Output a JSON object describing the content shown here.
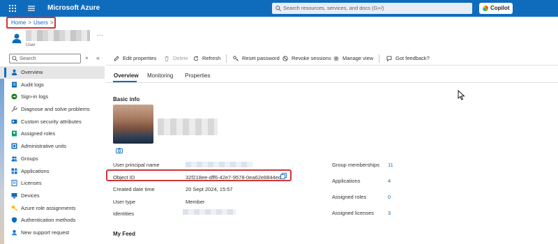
{
  "topbar": {
    "brand": "Microsoft Azure",
    "search_placeholder": "Search resources, services, and docs (G+/)",
    "copilot_label": "Copilot",
    "bg_color": "#0f6cbd"
  },
  "breadcrumb": {
    "home": "Home",
    "users": "Users"
  },
  "user": {
    "subtitle": "User"
  },
  "sidebar": {
    "search_placeholder": "Search",
    "items": [
      {
        "label": "Overview",
        "icon": "person-icon",
        "active": true
      },
      {
        "label": "Audit logs",
        "icon": "audit-log-icon"
      },
      {
        "label": "Sign-in logs",
        "icon": "sign-in-icon"
      },
      {
        "label": "Diagnose and solve problems",
        "icon": "wrench-icon"
      },
      {
        "label": "Custom security attributes",
        "icon": "attributes-icon"
      },
      {
        "label": "Assigned roles",
        "icon": "roles-icon"
      },
      {
        "label": "Administrative units",
        "icon": "admin-units-icon"
      },
      {
        "label": "Groups",
        "icon": "groups-icon"
      },
      {
        "label": "Applications",
        "icon": "applications-icon"
      },
      {
        "label": "Licenses",
        "icon": "licenses-icon"
      },
      {
        "label": "Devices",
        "icon": "devices-icon"
      },
      {
        "label": "Azure role assignments",
        "icon": "key-icon"
      },
      {
        "label": "Authentication methods",
        "icon": "shield-icon"
      },
      {
        "label": "New support request",
        "icon": "support-icon"
      }
    ]
  },
  "toolbar": {
    "edit": "Edit properties",
    "delete": "Delete",
    "refresh": "Refresh",
    "reset": "Reset password",
    "revoke": "Revoke sessions",
    "manage": "Manage view",
    "feedback": "Got feedback?"
  },
  "tabs": [
    "Overview",
    "Monitoring",
    "Properties"
  ],
  "basic_info": {
    "title": "Basic info",
    "props": {
      "upn_label": "User principal name",
      "objid_label": "Object ID",
      "objid_value": "32f218ee-dff6-42e7-9578-0ea62e8844ed",
      "created_label": "Created date time",
      "created_value": "20 Sept 2024, 15:57",
      "usertype_label": "User type",
      "usertype_value": "Member",
      "identities_label": "Identities"
    },
    "stats": [
      {
        "label": "Group memberships",
        "value": "11"
      },
      {
        "label": "Applications",
        "value": "4"
      },
      {
        "label": "Assigned roles",
        "value": "0"
      },
      {
        "label": "Assigned licenses",
        "value": "3"
      }
    ]
  },
  "feed": {
    "title": "My Feed"
  }
}
